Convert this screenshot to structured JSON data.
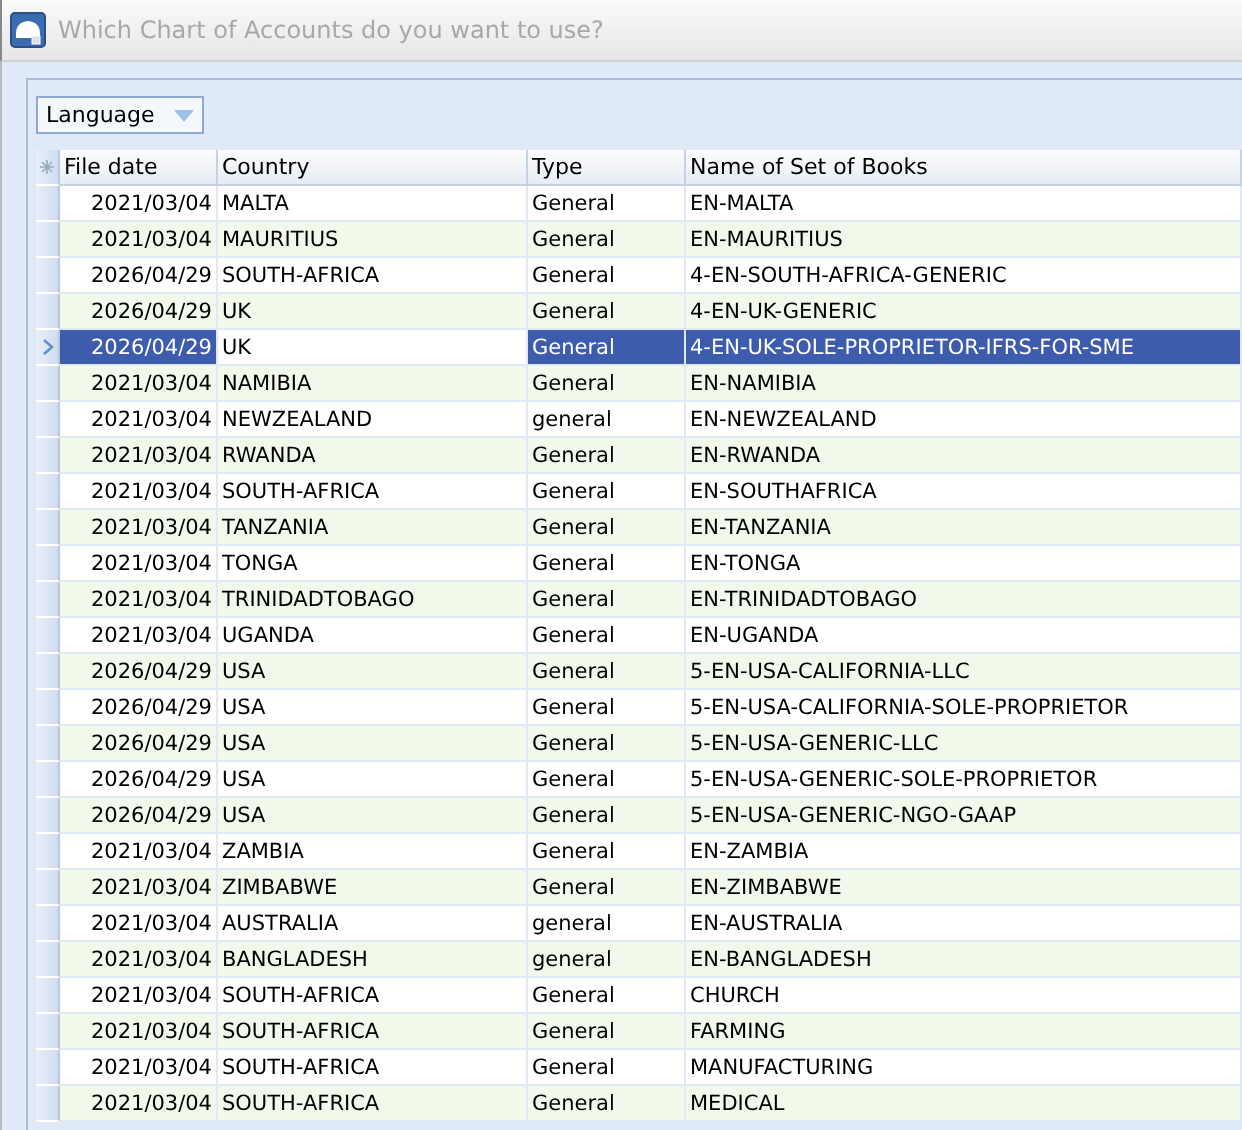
{
  "window": {
    "title": "Which Chart of Accounts do you want to use?"
  },
  "group_by": {
    "value": "Language"
  },
  "table": {
    "columns": [
      {
        "label": "File date"
      },
      {
        "label": "Country"
      },
      {
        "label": "Type"
      },
      {
        "label": "Name of Set of Books"
      }
    ],
    "rows": [
      {
        "date": "2021/03/04",
        "country": "MALTA",
        "type": "General",
        "name": "EN-MALTA",
        "selected": false
      },
      {
        "date": "2021/03/04",
        "country": "MAURITIUS",
        "type": "General",
        "name": "EN-MAURITIUS",
        "selected": false
      },
      {
        "date": "2026/04/29",
        "country": "SOUTH-AFRICA",
        "type": "General",
        "name": "4-EN-SOUTH-AFRICA-GENERIC",
        "selected": false
      },
      {
        "date": "2026/04/29",
        "country": "UK",
        "type": "General",
        "name": "4-EN-UK-GENERIC",
        "selected": false
      },
      {
        "date": "2026/04/29",
        "country": "UK",
        "type": "General",
        "name": "4-EN-UK-SOLE-PROPRIETOR-IFRS-FOR-SME",
        "selected": true,
        "country_focused": true
      },
      {
        "date": "2021/03/04",
        "country": "NAMIBIA",
        "type": "General",
        "name": "EN-NAMIBIA",
        "selected": false
      },
      {
        "date": "2021/03/04",
        "country": "NEWZEALAND",
        "type": "general",
        "name": "EN-NEWZEALAND",
        "selected": false
      },
      {
        "date": "2021/03/04",
        "country": "RWANDA",
        "type": "General",
        "name": "EN-RWANDA",
        "selected": false
      },
      {
        "date": "2021/03/04",
        "country": "SOUTH-AFRICA",
        "type": "General",
        "name": "EN-SOUTHAFRICA",
        "selected": false
      },
      {
        "date": "2021/03/04",
        "country": "TANZANIA",
        "type": "General",
        "name": "EN-TANZANIA",
        "selected": false
      },
      {
        "date": "2021/03/04",
        "country": "TONGA",
        "type": "General",
        "name": "EN-TONGA",
        "selected": false
      },
      {
        "date": "2021/03/04",
        "country": "TRINIDADTOBAGO",
        "type": "General",
        "name": "EN-TRINIDADTOBAGO",
        "selected": false
      },
      {
        "date": "2021/03/04",
        "country": "UGANDA",
        "type": "General",
        "name": "EN-UGANDA",
        "selected": false
      },
      {
        "date": "2026/04/29",
        "country": "USA",
        "type": "General",
        "name": "5-EN-USA-CALIFORNIA-LLC",
        "selected": false
      },
      {
        "date": "2026/04/29",
        "country": "USA",
        "type": "General",
        "name": "5-EN-USA-CALIFORNIA-SOLE-PROPRIETOR",
        "selected": false
      },
      {
        "date": "2026/04/29",
        "country": "USA",
        "type": "General",
        "name": "5-EN-USA-GENERIC-LLC",
        "selected": false
      },
      {
        "date": "2026/04/29",
        "country": "USA",
        "type": "General",
        "name": "5-EN-USA-GENERIC-SOLE-PROPRIETOR",
        "selected": false
      },
      {
        "date": "2026/04/29",
        "country": "USA",
        "type": "General",
        "name": "5-EN-USA-GENERIC-NGO-GAAP",
        "selected": false
      },
      {
        "date": "2021/03/04",
        "country": "ZAMBIA",
        "type": "General",
        "name": "EN-ZAMBIA",
        "selected": false
      },
      {
        "date": "2021/03/04",
        "country": "ZIMBABWE",
        "type": "General",
        "name": "EN-ZIMBABWE",
        "selected": false
      },
      {
        "date": "2021/03/04",
        "country": "AUSTRALIA",
        "type": "general",
        "name": "EN-AUSTRALIA",
        "selected": false
      },
      {
        "date": "2021/03/04",
        "country": "BANGLADESH",
        "type": "general",
        "name": "EN-BANGLADESH",
        "selected": false
      },
      {
        "date": "2021/03/04",
        "country": "SOUTH-AFRICA",
        "type": "General",
        "name": "CHURCH",
        "selected": false
      },
      {
        "date": "2021/03/04",
        "country": "SOUTH-AFRICA",
        "type": "General",
        "name": "FARMING",
        "selected": false
      },
      {
        "date": "2021/03/04",
        "country": "SOUTH-AFRICA",
        "type": "General",
        "name": "MANUFACTURING",
        "selected": false
      },
      {
        "date": "2021/03/04",
        "country": "SOUTH-AFRICA",
        "type": "General",
        "name": "MEDICAL",
        "selected": false
      }
    ]
  }
}
